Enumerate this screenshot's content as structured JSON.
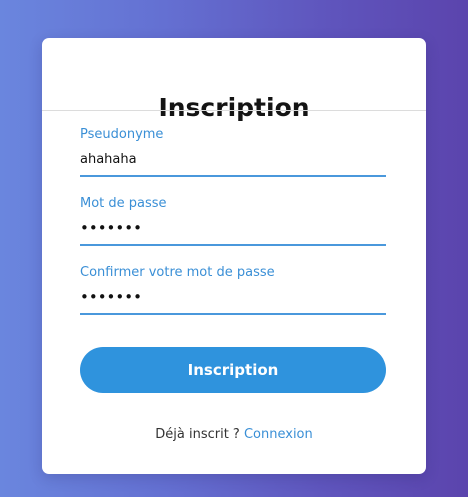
{
  "form": {
    "title": "Inscription",
    "fields": [
      {
        "label": "Pseudonyme",
        "value": "ahahaha",
        "type": "text"
      },
      {
        "label": "Mot de passe",
        "value": "•••••••",
        "type": "password"
      },
      {
        "label": "Confirmer votre mot de passe",
        "value": "•••••••",
        "type": "password"
      }
    ],
    "submit_label": "Inscription",
    "footer": {
      "prompt": "Déjà inscrit ?",
      "link_label": "Connexion"
    }
  },
  "colors": {
    "accent": "#3a8fd6",
    "button": "#2f93dd",
    "background_gradient": [
      "#6a86de",
      "#5b44ad"
    ]
  }
}
